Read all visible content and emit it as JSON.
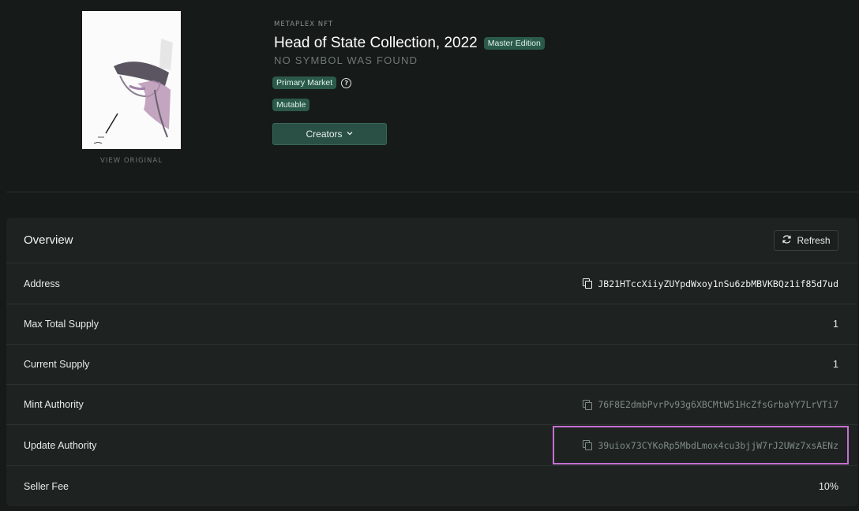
{
  "nft": {
    "view_original": "VIEW ORIGINAL",
    "eyebrow": "METAPLEX NFT",
    "title": "Head of State Collection, 2022",
    "edition_badge": "Master Edition",
    "symbol": "NO SYMBOL WAS FOUND",
    "market_badge": "Primary Market",
    "mutable_badge": "Mutable",
    "creators_button": "Creators"
  },
  "overview": {
    "title": "Overview",
    "refresh_label": "Refresh",
    "rows": [
      {
        "label": "Address",
        "value": "JB21HTccXiiyZUYpdWxoy1nSu6zbMBVKBQz1if85d7ud"
      },
      {
        "label": "Max Total Supply",
        "value": "1"
      },
      {
        "label": "Current Supply",
        "value": "1"
      },
      {
        "label": "Mint Authority",
        "value": "76F8E2dmbPvrPv93g6XBCMtW51HcZfsGrbaYY7LrVTi7"
      },
      {
        "label": "Update Authority",
        "value": "39uiox73CYKoRp5MbdLmox4cu3bjjW7rJ2UWz7xsAENz"
      },
      {
        "label": "Seller Fee",
        "value": "10%"
      }
    ]
  },
  "colors": {
    "accent": "#2b5a4b",
    "highlight": "#c76fd1",
    "background": "#161a19"
  }
}
